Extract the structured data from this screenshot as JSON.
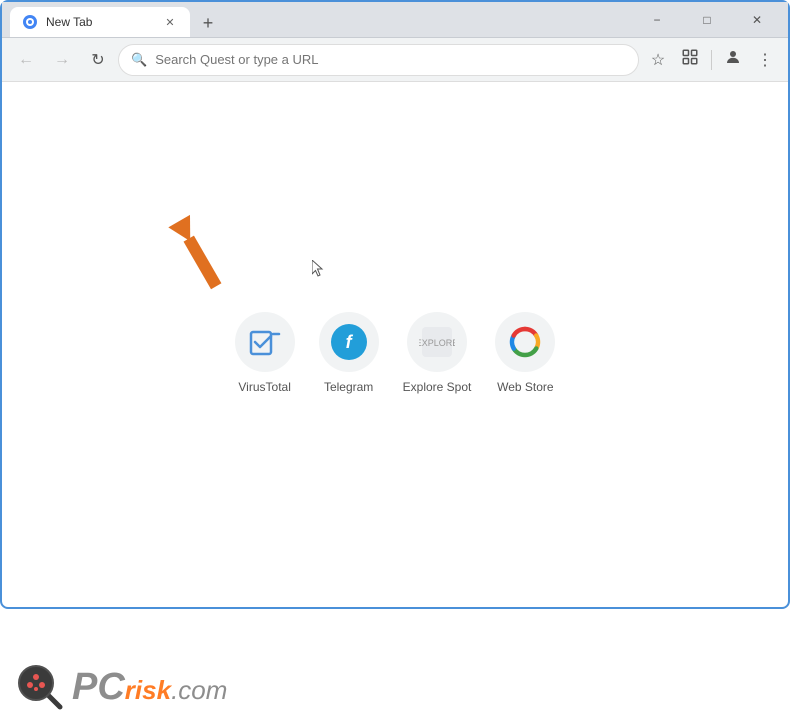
{
  "window": {
    "title": "New Tab",
    "minimize_label": "−",
    "maximize_label": "□",
    "close_label": "✕"
  },
  "tab": {
    "title": "New Tab",
    "new_tab_btn": "+"
  },
  "nav": {
    "back_label": "←",
    "forward_label": "→",
    "refresh_label": "↻",
    "search_placeholder": "Search Quest or type a URL",
    "bookmark_label": "☆",
    "extensions_label": "⧉",
    "profile_label": "👤",
    "menu_label": "⋮"
  },
  "shortcuts": [
    {
      "id": "virustotal",
      "label": "VirusTotal",
      "type": "vt"
    },
    {
      "id": "telegram",
      "label": "Telegram",
      "type": "tg"
    },
    {
      "id": "explore-spot",
      "label": "Explore Spot",
      "type": "es"
    },
    {
      "id": "web-store",
      "label": "Web Store",
      "type": "ws"
    }
  ],
  "watermark": {
    "pc": "PC",
    "risk": "risk",
    "dot": ".",
    "com": "com"
  },
  "colors": {
    "accent": "#4a90d9",
    "arrow": "#e07020",
    "tab_active_bg": "#ffffff",
    "nav_bar_bg": "#f1f3f4"
  }
}
